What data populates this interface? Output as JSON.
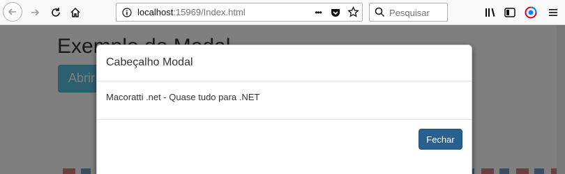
{
  "browser": {
    "url_host": "localhost",
    "url_port_path": ":15969/Index.html",
    "search_placeholder": "Pesquisar",
    "more_label": "•••"
  },
  "page": {
    "title": "Exemplo de Modal",
    "open_button_label": "Abrir"
  },
  "modal": {
    "title": "Cabeçalho Modal",
    "body_text": "Macoratti .net - Quase tudo para .NET",
    "close_button_label": "Fechar"
  },
  "colors": {
    "primary_button": "#286090",
    "info_button": "#5bc0de",
    "overlay": "rgba(0,0,0,0.5)"
  }
}
